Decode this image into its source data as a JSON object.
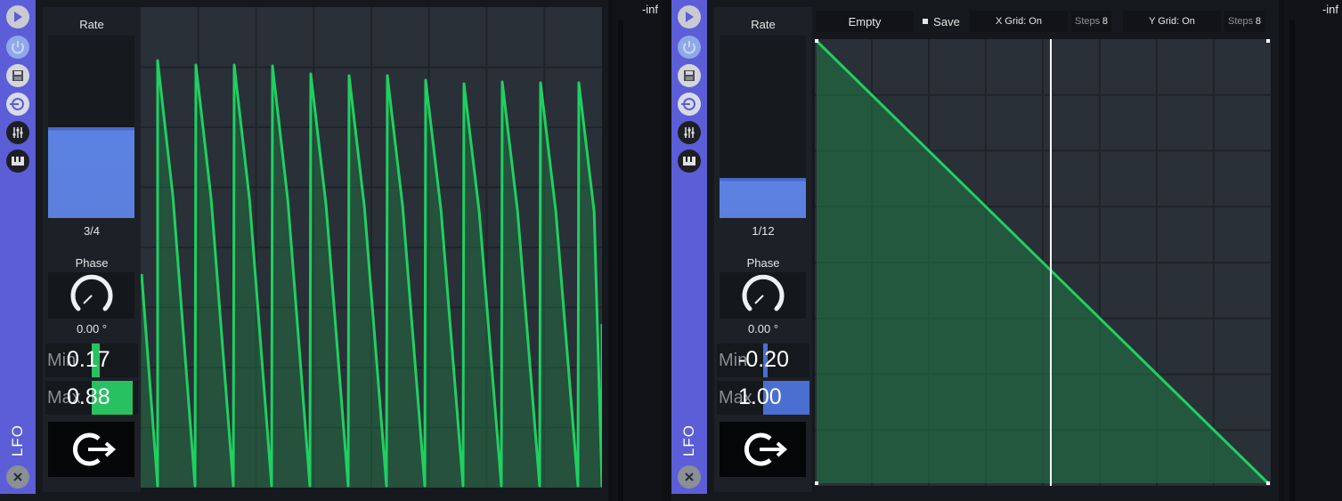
{
  "units": [
    {
      "rail": {
        "title": "LFO"
      },
      "rate": {
        "label": "Rate",
        "value": "3/4",
        "fill_fraction": 0.5
      },
      "phase": {
        "label": "Phase",
        "value": "0.00 °"
      },
      "min": {
        "label": "Min",
        "value": "0.17",
        "fill_fraction": 0.17,
        "fill_color": "#27c161"
      },
      "max": {
        "label": "Max",
        "value": "0.88",
        "fill_fraction": 0.88,
        "fill_color": "#27c161"
      },
      "meter": {
        "value": "-inf"
      }
    },
    {
      "rail": {
        "title": "LFO"
      },
      "rate": {
        "label": "Rate",
        "value": "1/12",
        "fill_fraction": 0.22
      },
      "phase": {
        "label": "Phase",
        "value": "0.00 °"
      },
      "min": {
        "label": "Min",
        "value": "-0.20",
        "fill_fraction": 0.1,
        "fill_color": "#4a6fd0"
      },
      "max": {
        "label": "Max",
        "value": "1.00",
        "fill_fraction": 1.0,
        "fill_color": "#4a6fd0"
      },
      "meter": {
        "value": "-inf"
      },
      "toolbar": {
        "preset": "Empty",
        "save": "Save",
        "x_grid": "X Grid: On",
        "x_steps_label": "Steps",
        "x_steps_value": "8",
        "y_grid": "Y Grid: On",
        "y_steps_label": "Steps",
        "y_steps_value": "8"
      }
    }
  ],
  "colors": {
    "rail": "#5b5ed6",
    "wave": "#1fd060",
    "wave_fill": "#1f7a45",
    "rate_fill": "#5b82e2",
    "graph_bg": "#2a3037",
    "grid": "#1f242a"
  }
}
